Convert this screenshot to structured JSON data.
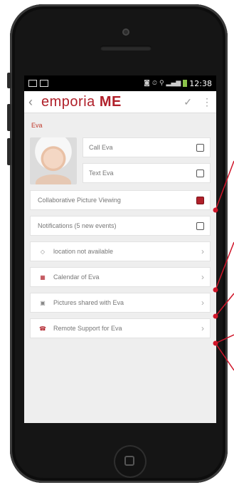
{
  "status_bar": {
    "time": "12:38"
  },
  "app_bar": {
    "brand_prefix": "empor",
    "brand_o": "ia",
    "brand_suffix": "ME"
  },
  "contact": {
    "name": "Eva"
  },
  "actions": {
    "call_label": "Call Eva",
    "text_label": "Text Eva"
  },
  "items": [
    {
      "label": "Collaborative Picture Viewing",
      "icon": "red-square-icon"
    },
    {
      "label": "Notifications (5 new events)",
      "icon": "square-icon"
    },
    {
      "label": "location not available",
      "icon": "location-icon"
    },
    {
      "label": "Calendar of Eva",
      "icon": "calendar-icon"
    },
    {
      "label": "Pictures shared with Eva",
      "icon": "picture-icon"
    },
    {
      "label": "Remote Support for Eva",
      "icon": "support-icon"
    }
  ],
  "colors": {
    "accent": "#b0202a",
    "callout": "#d0162a"
  }
}
